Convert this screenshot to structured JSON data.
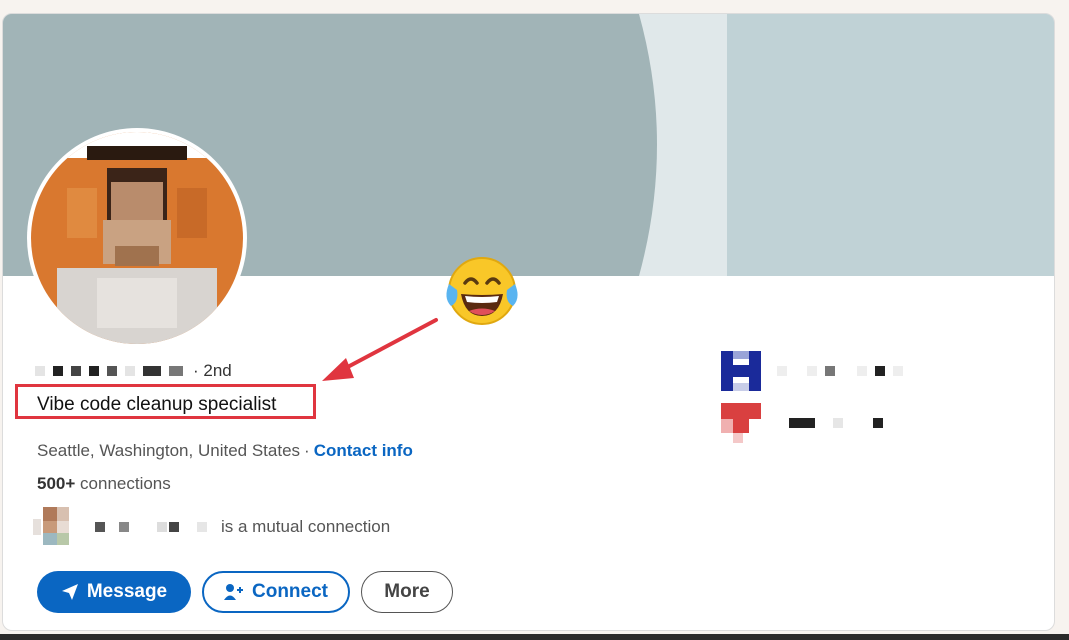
{
  "profile": {
    "degree": "· 2nd",
    "headline": "Vibe code cleanup specialist",
    "location": "Seattle, Washington, United States",
    "location_separator": "·",
    "contact_label": "Contact info",
    "connections_count": "500+",
    "connections_label": "connections",
    "mutual_text": "is a mutual connection"
  },
  "actions": {
    "message_label": "Message",
    "connect_label": "Connect",
    "more_label": "More"
  },
  "annotation": {
    "emoji": "face-with-tears-of-joy-emoji",
    "highlight_color": "#e0353f",
    "arrow_color": "#e0353f"
  },
  "colors": {
    "accent": "#0a66c2",
    "banner_left": "#a1b4b7",
    "banner_right": "#c0d2d6",
    "banner_band": "#e0e8ea"
  }
}
